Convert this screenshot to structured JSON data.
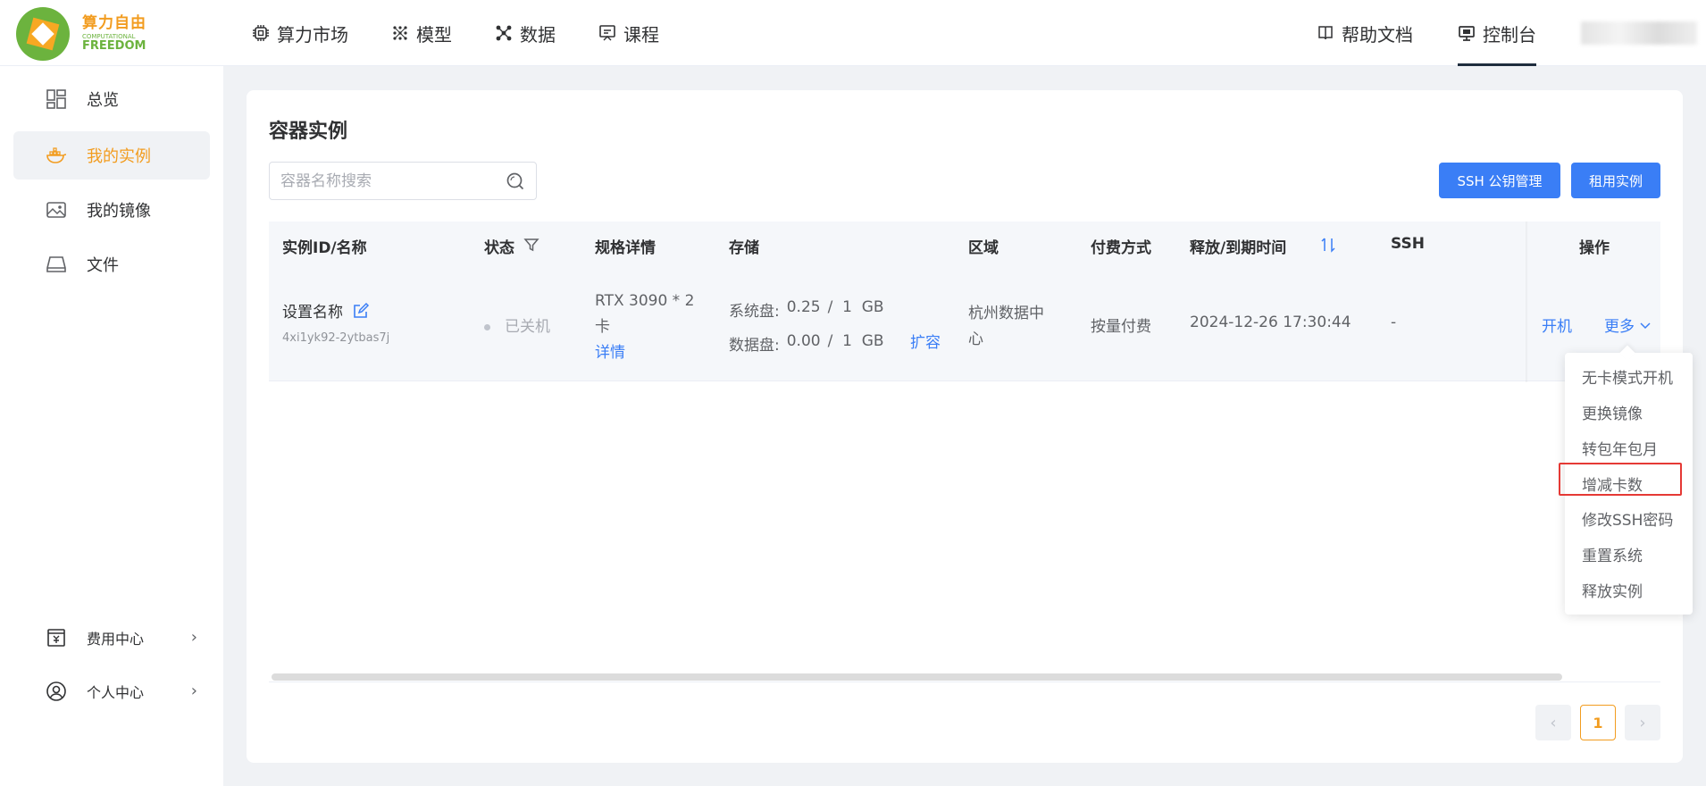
{
  "brand": {
    "name_cn": "算力自由",
    "name_en_small": "COMPUTATIONAL",
    "name_en": "FREEDOM",
    "colors": {
      "orange": "#f29c1f",
      "green": "#6cb33e",
      "primary": "#3a7ef6"
    }
  },
  "topnav": {
    "left": [
      {
        "label": "算力市场",
        "icon": "chip-icon"
      },
      {
        "label": "模型",
        "icon": "model-grid-icon"
      },
      {
        "label": "数据",
        "icon": "data-nodes-icon"
      },
      {
        "label": "课程",
        "icon": "course-icon"
      }
    ],
    "right": [
      {
        "label": "帮助文档",
        "icon": "book-icon"
      },
      {
        "label": "控制台",
        "icon": "monitor-icon",
        "active": true
      }
    ]
  },
  "sidebar": {
    "items": [
      {
        "label": "总览",
        "icon": "dashboard-icon"
      },
      {
        "label": "我的实例",
        "icon": "container-icon",
        "active": true
      },
      {
        "label": "我的镜像",
        "icon": "image-icon"
      },
      {
        "label": "文件",
        "icon": "drive-icon"
      }
    ],
    "bottom": [
      {
        "label": "费用中心",
        "icon": "billing-icon"
      },
      {
        "label": "个人中心",
        "icon": "user-circle-icon"
      }
    ]
  },
  "page": {
    "title": "容器实例",
    "search_placeholder": "容器名称搜索",
    "btn_ssh": "SSH 公钥管理",
    "btn_rent": "租用实例"
  },
  "table": {
    "headers": {
      "id": "实例ID/名称",
      "status": "状态",
      "spec": "规格详情",
      "storage": "存储",
      "region": "区域",
      "pay": "付费方式",
      "time": "释放/到期时间",
      "ssh": "SSH",
      "ops": "操作"
    },
    "row": {
      "name": "设置名称",
      "id": "4xi1yk92-2ytbas7j",
      "status": "已关机",
      "spec_line1": "RTX 3090 * 2",
      "spec_line2": "卡",
      "spec_detail": "详情",
      "sys_disk_label": "系统盘:",
      "sys_disk_value": "0.25",
      "sys_disk_total": "/  1  GB",
      "data_disk_label": "数据盘:",
      "data_disk_value": "0.00",
      "data_disk_total": "/  1  GB",
      "expand": "扩容",
      "region_line1": "杭州数据中",
      "region_line2": "心",
      "pay": "按量付费",
      "time": "2024-12-26 17:30:44",
      "ssh": "-",
      "op_start": "开机",
      "op_more": "更多"
    }
  },
  "dropdown": {
    "items": [
      "无卡模式开机",
      "更换镜像",
      "转包年包月",
      "增减卡数",
      "修改SSH密码",
      "重置系统",
      "释放实例"
    ],
    "highlighted_index": 3
  },
  "pagination": {
    "current": "1",
    "prev": "‹",
    "next": "›"
  }
}
